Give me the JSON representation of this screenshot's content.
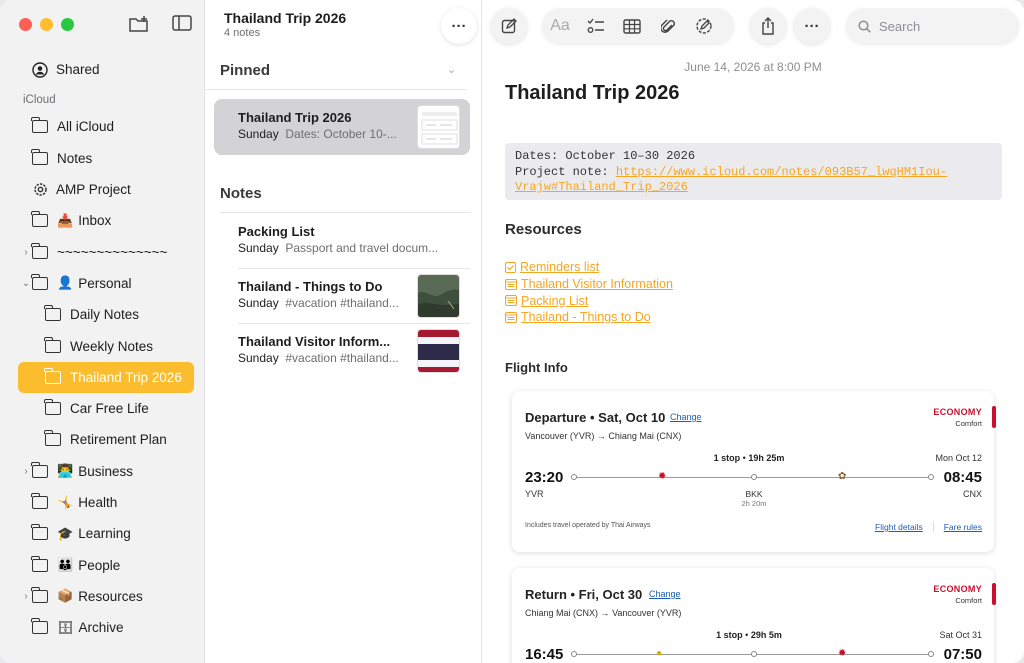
{
  "sidebar": {
    "shared_label": "Shared",
    "section_label": "iCloud",
    "items": [
      {
        "label": "All iCloud",
        "emoji": ""
      },
      {
        "label": "Notes",
        "emoji": ""
      },
      {
        "label": "AMP Project",
        "emoji": ""
      },
      {
        "label": "Inbox",
        "emoji": "📥"
      },
      {
        "label": "~~~~~~~~~~~~~~",
        "emoji": ""
      },
      {
        "label": "Personal",
        "emoji": "👤"
      },
      {
        "label": "Daily Notes",
        "emoji": ""
      },
      {
        "label": "Weekly Notes",
        "emoji": ""
      },
      {
        "label": "Thailand Trip 2026",
        "emoji": ""
      },
      {
        "label": "Car Free Life",
        "emoji": ""
      },
      {
        "label": "Retirement Plan",
        "emoji": ""
      },
      {
        "label": "Business",
        "emoji": "👨‍💻"
      },
      {
        "label": "Health",
        "emoji": "🤸"
      },
      {
        "label": "Learning",
        "emoji": "🎓"
      },
      {
        "label": "People",
        "emoji": "👪"
      },
      {
        "label": "Resources",
        "emoji": "📦"
      },
      {
        "label": "Archive",
        "emoji": "🗄"
      }
    ]
  },
  "notelist": {
    "title": "Thailand Trip 2026",
    "count": "4 notes",
    "pinned_label": "Pinned",
    "notes_label": "Notes",
    "pinned": [
      {
        "title": "Thailand Trip 2026",
        "day": "Sunday",
        "preview": "Dates: October 10-..."
      }
    ],
    "notes": [
      {
        "title": "Packing List",
        "day": "Sunday",
        "preview": "Passport and travel docum..."
      },
      {
        "title": "Thailand - Things to Do",
        "day": "Sunday",
        "preview": "#vacation #thailand..."
      },
      {
        "title": "Thailand Visitor Inform...",
        "day": "Sunday",
        "preview": "#vacation #thailand..."
      }
    ]
  },
  "toolbar": {
    "search_placeholder": "Search",
    "format_label": "Aa"
  },
  "note": {
    "date": "June 14, 2026 at 8:00 PM",
    "title": "Thailand Trip 2026",
    "code_line1": "Dates: October 10–30 2026",
    "code_line2_label": "Project note: ",
    "code_link": "https://www.icloud.com/notes/093B57_lwqHM1Iou-Vrajw#Thailand_Trip_2026",
    "resources_heading": "Resources",
    "resources": [
      "Reminders list",
      "Thailand Visitor Information",
      "Packing List",
      "Thailand - Things to Do"
    ],
    "flight_heading": "Flight Info"
  },
  "flights": [
    {
      "heading": "Departure • Sat, Oct 10",
      "change": "Change",
      "route_from": "Vancouver (YVR)",
      "route_to": "Chiang Mai (CNX)",
      "class": "ECONOMY",
      "class_sub": "Comfort",
      "stops": "1 stop",
      "duration": "19h 25m",
      "arr_day": "Mon Oct 12",
      "dep_time": "23:20",
      "arr_time": "08:45",
      "dep_code": "YVR",
      "arr_code": "CNX",
      "via": "BKK",
      "via_layover": "2h 20m",
      "note": "Includes travel operated by Thai Airways",
      "details_link": "Flight details",
      "fare_link": "Fare rules"
    },
    {
      "heading": "Return • Fri, Oct 30",
      "change": "Change",
      "route_from": "Chiang Mai (CNX)",
      "route_to": "Vancouver (YVR)",
      "class": "ECONOMY",
      "class_sub": "Comfort",
      "stops": "1 stop",
      "duration": "29h 5m",
      "arr_day": "Sat Oct 31",
      "dep_time": "16:45",
      "arr_time": "07:50"
    }
  ],
  "colors": {
    "accent": "#fbbd2d",
    "link": "#f5a623",
    "airline": "#c8102e"
  }
}
